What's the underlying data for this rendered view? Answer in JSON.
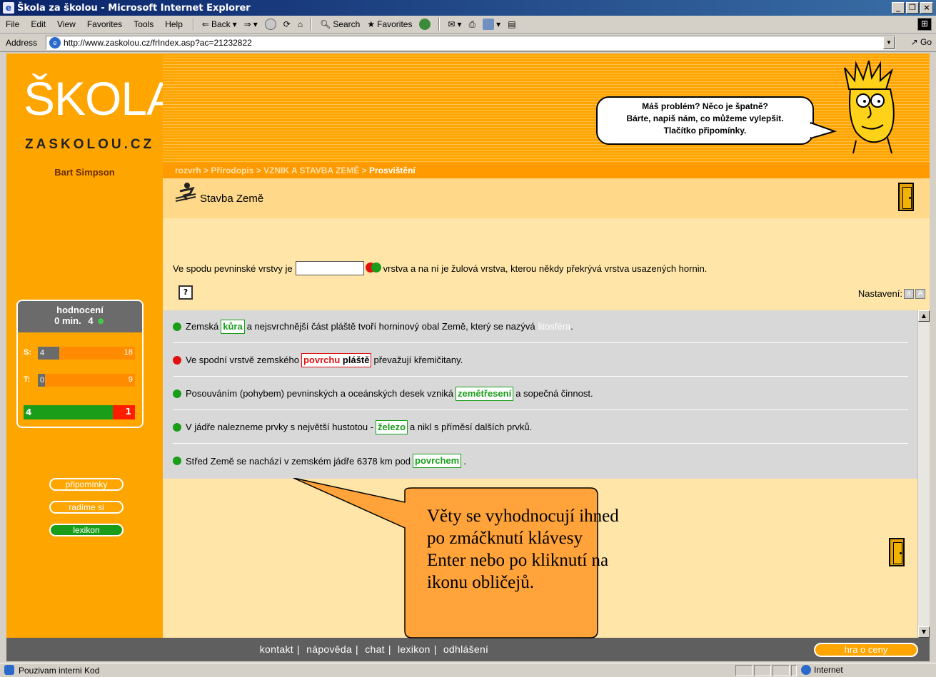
{
  "window": {
    "title": "Škola za školou - Microsoft Internet Explorer",
    "controls": [
      "_",
      "❐",
      "×"
    ]
  },
  "menubar": {
    "items": [
      "File",
      "Edit",
      "View",
      "Favorites",
      "Tools",
      "Help"
    ],
    "back_label": "Back",
    "search_label": "Search",
    "favorites_label": "Favorites"
  },
  "addressbar": {
    "label": "Address",
    "url": "http://www.zaskolou.cz/frIndex.asp?ac=21232822",
    "go_label": "Go"
  },
  "header": {
    "logo": "ŠKOLA",
    "logo_sub": "ZASKOLOU.CZ",
    "bubble_lines": [
      "Máš problém? Něco je špatně?",
      "Bárte, napiš nám, co můžeme vylepšit.",
      "Tlačítko připomínky."
    ]
  },
  "sidebar": {
    "username": "Bart Simpson",
    "rating": {
      "title": "hodnocení",
      "time": "0 min.",
      "score": "4",
      "s_label": "S:",
      "s_value": "4",
      "s_max": "18",
      "s_fraction": 0.22,
      "t_label": "T:",
      "t_value": "0",
      "t_max": "9",
      "t_fraction": 0.0,
      "good": "4",
      "bad": "1",
      "good_fraction": 0.8
    },
    "buttons": {
      "pripominky": "připomínky",
      "radime": "radíme si",
      "lexikon": "lexikon"
    }
  },
  "breadcrumb": {
    "items": [
      "rozvrh",
      "Přírodopis",
      "VZNIK A STAVBA ZEMĚ"
    ],
    "separator": ">",
    "current": "Prosvištění"
  },
  "content": {
    "title": "Stavba Země",
    "question_before": "Ve spodu pevninské vrstvy je",
    "question_after": "vrstva a na ní je žulová vrstva, kterou někdy překrývá vrstva usazených hornin.",
    "settings_label": "Nastavení:",
    "sentences": [
      {
        "before": "Zemská",
        "answer": "kůra",
        "after": "a nejsvrchnější část pláště tvoří horninový obal Země, který se nazývá",
        "hint": "litosféra",
        "end": ".",
        "status": "ok"
      },
      {
        "before": "Ve spodní vrstvě zemského",
        "answer": "povrchu",
        "correct": "pláště",
        "after": "převažují křemičitany.",
        "status": "bad"
      },
      {
        "before": "Posouváním (pohybem) pevninských a oceánských desek vzniká",
        "answer": "zemětřesení",
        "after": "a sopečná činnost.",
        "status": "ok"
      },
      {
        "before": "V jádře nalezneme prvky s největší hustotou -",
        "answer": "železo",
        "after": "a nikl s příměsí dalších prvků.",
        "status": "ok"
      },
      {
        "before": "Střed Země se nachází v zemském jádře 6378 km pod",
        "answer": "povrchem",
        "after": ".",
        "status": "ok"
      }
    ]
  },
  "callout": {
    "lines": [
      "Věty se vyhodnocují ihned",
      "po zmáčknutí klávesy",
      "Enter nebo po kliknutí na",
      "ikonu obličejů."
    ]
  },
  "footer": {
    "links": [
      "kontakt",
      "nápověda",
      "chat",
      "lexikon",
      "odhlášení"
    ],
    "game_button": "hra o ceny"
  },
  "statusbar": {
    "left": "Pouzivam interni Kod",
    "zone": "Internet"
  },
  "colors": {
    "orange": "#ffa500",
    "ok_green": "#1a9e1a",
    "bad_red": "#e01010",
    "footer_gray": "#5f5f5f"
  }
}
